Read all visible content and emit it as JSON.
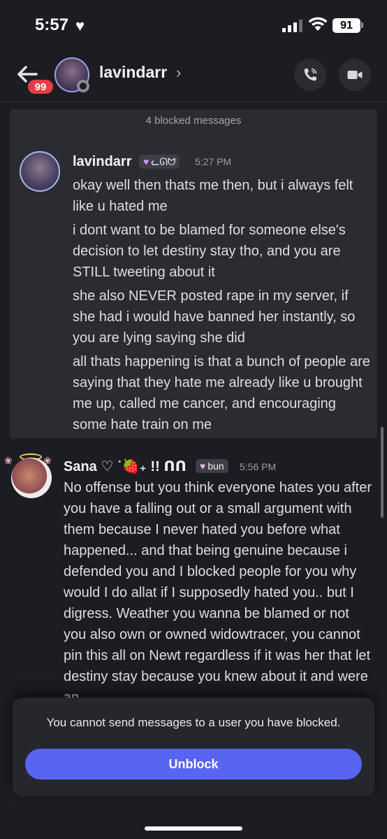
{
  "status_bar": {
    "time": "5:57",
    "battery": "91"
  },
  "header": {
    "badge_count": "99",
    "name": "lavindarr",
    "chevron": "›"
  },
  "blocked_section": {
    "label": "4 blocked messages",
    "message": {
      "author": "lavindarr",
      "tag": "ᓚᘏᗢ",
      "time": "5:27 PM",
      "paragraphs": [
        "okay well then thats me then, but i always felt like u hated me",
        "i dont want to be blamed for someone else's decision to let destiny stay tho, and you are STILL tweeting about it",
        "she also NEVER posted rape in my server, if she had i would have banned her instantly, so you are lying saying she did",
        "all thats happening is that a bunch of people are saying that they hate me already like u brought me up, called me cancer, and encouraging some hate train on me"
      ]
    }
  },
  "message2": {
    "author": "Sana ♡ ˙🍓₊ !! ᑎᑎ",
    "tag": "bun",
    "time": "5:56 PM",
    "body": "No offense but you think everyone hates you after you have a falling out or a small argument with them because I never hated you before what happened... and that being genuine because i defended you and I blocked people for you why would I do allat if I supposedly hated you.. but I digress. Weather you wanna be blamed or not you also own or owned widowtracer, you cannot pin this all on Newt regardless if it was her that let destiny stay because you knew about it and were an"
  },
  "footer": {
    "notice": "You cannot send messages to a user you have blocked.",
    "unblock_label": "Unblock"
  },
  "colors": {
    "accent": "#5865f2",
    "badge": "#e53d45",
    "background": "#1c1d22"
  }
}
